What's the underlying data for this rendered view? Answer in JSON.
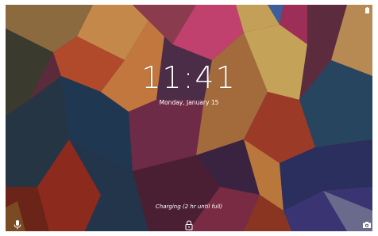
{
  "lockscreen": {
    "time": "11:41",
    "date": "Monday, January 15",
    "charging_status": "Charging (2 hr until full)"
  },
  "icons": {
    "battery": "battery-full-icon",
    "voice": "microphone-icon",
    "unlock": "lock-icon",
    "camera": "camera-icon"
  }
}
